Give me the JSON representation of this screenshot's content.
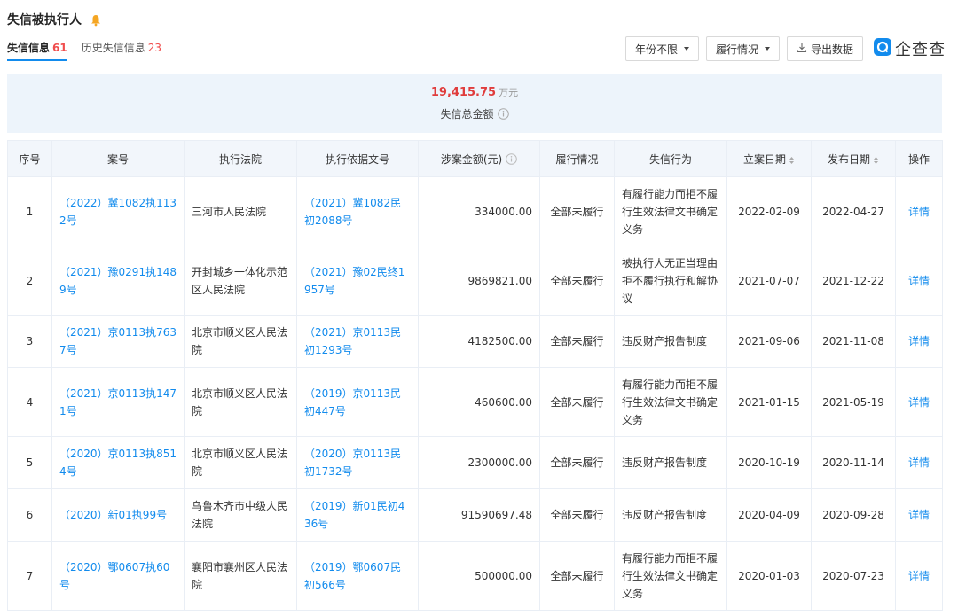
{
  "header": {
    "title": "失信被执行人"
  },
  "tabs": [
    {
      "label": "失信信息",
      "count": "61"
    },
    {
      "label": "历史失信信息",
      "count": "23"
    }
  ],
  "toolbar": {
    "year_filter": "年份不限",
    "status_filter": "履行情况",
    "export_label": "导出数据",
    "brand": "企查查"
  },
  "summary": {
    "amount": "19,415.75",
    "unit": "万元",
    "label": "失信总金额"
  },
  "table": {
    "headers": [
      "序号",
      "案号",
      "执行法院",
      "执行依据文号",
      "涉案金额(元)",
      "履行情况",
      "失信行为",
      "立案日期",
      "发布日期",
      "操作"
    ],
    "rows": [
      {
        "no": "1",
        "case": "（2022）冀1082执1132号",
        "court": "三河市人民法院",
        "basis": "（2021）冀1082民初2088号",
        "amount": "334000.00",
        "status": "全部未履行",
        "behavior": "有履行能力而拒不履行生效法律文书确定义务",
        "filed": "2022-02-09",
        "published": "2022-04-27",
        "action": "详情"
      },
      {
        "no": "2",
        "case": "（2021）豫0291执1489号",
        "court": "开封城乡一体化示范区人民法院",
        "basis": "（2021）豫02民终1957号",
        "amount": "9869821.00",
        "status": "全部未履行",
        "behavior": "被执行人无正当理由拒不履行执行和解协议",
        "filed": "2021-07-07",
        "published": "2021-12-22",
        "action": "详情"
      },
      {
        "no": "3",
        "case": "（2021）京0113执7637号",
        "court": "北京市顺义区人民法院",
        "basis": "（2021）京0113民初1293号",
        "amount": "4182500.00",
        "status": "全部未履行",
        "behavior": "违反财产报告制度",
        "filed": "2021-09-06",
        "published": "2021-11-08",
        "action": "详情"
      },
      {
        "no": "4",
        "case": "（2021）京0113执1471号",
        "court": "北京市顺义区人民法院",
        "basis": "（2019）京0113民初447号",
        "amount": "460600.00",
        "status": "全部未履行",
        "behavior": "有履行能力而拒不履行生效法律文书确定义务",
        "filed": "2021-01-15",
        "published": "2021-05-19",
        "action": "详情"
      },
      {
        "no": "5",
        "case": "（2020）京0113执8514号",
        "court": "北京市顺义区人民法院",
        "basis": "（2020）京0113民初1732号",
        "amount": "2300000.00",
        "status": "全部未履行",
        "behavior": "违反财产报告制度",
        "filed": "2020-10-19",
        "published": "2020-11-14",
        "action": "详情"
      },
      {
        "no": "6",
        "case": "（2020）新01执99号",
        "court": "乌鲁木齐市中级人民法院",
        "basis": "（2019）新01民初436号",
        "amount": "91590697.48",
        "status": "全部未履行",
        "behavior": "违反财产报告制度",
        "filed": "2020-04-09",
        "published": "2020-09-28",
        "action": "详情"
      },
      {
        "no": "7",
        "case": "（2020）鄂0607执60号",
        "court": "襄阳市襄州区人民法院",
        "basis": "（2019）鄂0607民初566号",
        "amount": "500000.00",
        "status": "全部未履行",
        "behavior": "有履行能力而拒不履行生效法律文书确定义务",
        "filed": "2020-01-03",
        "published": "2020-07-23",
        "action": "详情"
      }
    ]
  },
  "colors": {
    "accent": "#128bed",
    "danger": "#e03c3c",
    "bell": "#f5a623"
  }
}
